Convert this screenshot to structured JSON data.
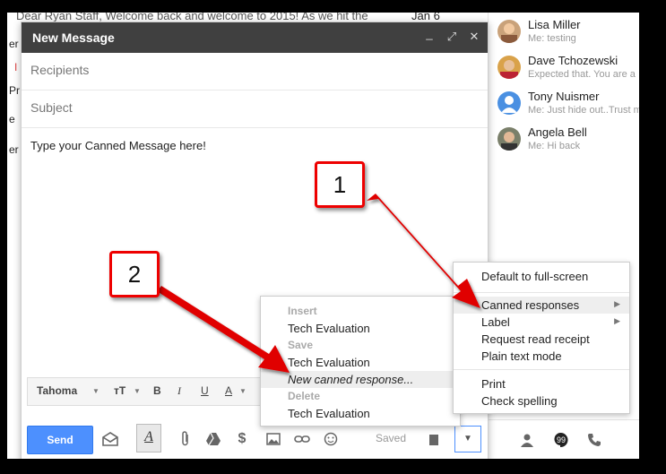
{
  "inbox_bg": {
    "preview_line": "Dear Ryan Staff, Welcome back and welcome to 2015! As we hit the",
    "date": "Jan 6",
    "frag_1": "er",
    "frag_2": "I",
    "frag_3": "Pr",
    "frag_4": "e",
    "frag_5": "er"
  },
  "chat": {
    "contacts": [
      {
        "name": "Lisa Miller",
        "status": "Me: testing"
      },
      {
        "name": "Dave Tchozewski",
        "status": "Expected that. You are a"
      },
      {
        "name": "Tony Nuismer",
        "status": "Me: Just hide out..Trust m"
      },
      {
        "name": "Angela Bell",
        "status": "Me: Hi back"
      }
    ]
  },
  "compose": {
    "title": "New Message",
    "minimize_glyph": "_",
    "popout_glyph": "⤢",
    "close_glyph": "✕",
    "recipients_placeholder": "Recipients",
    "subject_placeholder": "Subject",
    "body": "Type your Canned Message here!",
    "format": {
      "font": "Tahoma",
      "size_glyph": "тT",
      "bold": "B",
      "italic": "I",
      "underline": "U",
      "color": "A"
    },
    "send_label": "Send",
    "saved_label": "Saved",
    "more_glyph": "▼"
  },
  "canned_menu": {
    "insert_header": "Insert",
    "insert_item": "Tech Evaluation",
    "save_header": "Save",
    "save_item": "Tech Evaluation",
    "new_item": "New canned response...",
    "delete_header": "Delete",
    "delete_item": "Tech Evaluation"
  },
  "options_menu": {
    "full_screen": "Default to full-screen",
    "canned": "Canned responses",
    "label": "Label",
    "read_receipt": "Request read receipt",
    "plain_text": "Plain text mode",
    "print": "Print",
    "spell": "Check spelling"
  },
  "callouts": {
    "one": "1",
    "two": "2"
  },
  "colors": {
    "annotation_red": "#e00000",
    "send_blue": "#4d90fe",
    "compose_header": "#404040"
  }
}
